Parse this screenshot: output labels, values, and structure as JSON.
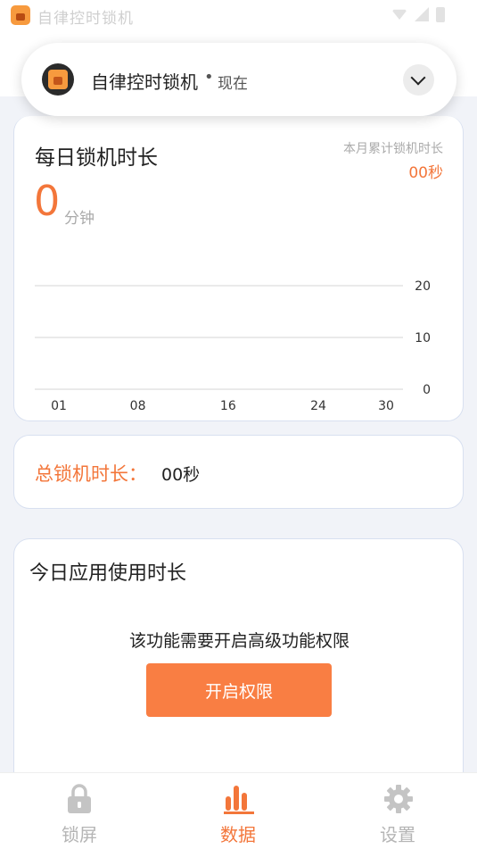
{
  "status_bar": {
    "app_title": "自律控时锁机"
  },
  "notification": {
    "app_name": "自律控时锁机",
    "separator": "•",
    "time": "现在"
  },
  "daily_card": {
    "title": "每日锁机时长",
    "month_label": "本月累计锁机时长",
    "month_value": "00秒",
    "today_value": "0",
    "today_unit": "分钟"
  },
  "chart_data": {
    "type": "line",
    "x": [],
    "x_ticks": [
      "01",
      "08",
      "16",
      "24",
      "30"
    ],
    "y_ticks": [
      "0",
      "10",
      "20"
    ],
    "ylim": [
      0,
      20
    ],
    "series": [],
    "grid": true
  },
  "total_card": {
    "label": "总锁机时长：",
    "value": "00秒"
  },
  "usage_card": {
    "title": "今日应用使用时长",
    "message": "该功能需要开启高级功能权限",
    "button_label": "开启权限"
  },
  "bottom_nav": {
    "items": [
      {
        "label": "锁屏",
        "icon": "lock-icon",
        "active": false
      },
      {
        "label": "数据",
        "icon": "bar-chart-icon",
        "active": true
      },
      {
        "label": "设置",
        "icon": "gear-icon",
        "active": false
      }
    ]
  },
  "colors": {
    "accent": "#f3763a",
    "button": "#f97e43",
    "background": "#f1f3f8",
    "inactive": "#b5b5b5"
  }
}
